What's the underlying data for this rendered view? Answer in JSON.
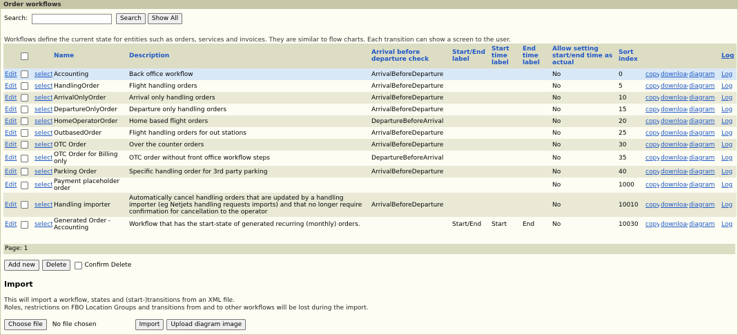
{
  "title": "Order workflows",
  "search": {
    "label": "Search:",
    "value": "",
    "search_button": "Search",
    "show_all_button": "Show All"
  },
  "description": "Workflows define the current state for entities such as orders, services and invoices. They are similar to flow charts. Each transition can show a screen to the user.",
  "columns": {
    "name": "Name",
    "description": "Description",
    "arrival_check": "Arrival before departure check",
    "start_end_label": "Start/End label",
    "start_time_label": "Start time label",
    "end_time_label": "End time label",
    "allow_setting": "Allow setting start/end time as actual",
    "sort_index": "Sort index",
    "log": "Log"
  },
  "row_links": {
    "edit": "Edit",
    "select": "select",
    "copy": "copy",
    "download": "download",
    "diagram": "diagram",
    "log": "Log"
  },
  "rows": [
    {
      "name": "Accounting",
      "description": "Back office workflow",
      "arrival_check": "ArrivalBeforeDeparture",
      "start_end_label": "",
      "start_time_label": "",
      "end_time_label": "",
      "allow_setting": "No",
      "sort_index": "0"
    },
    {
      "name": "HandlingOrder",
      "description": "Flight handling orders",
      "arrival_check": "ArrivalBeforeDeparture",
      "start_end_label": "",
      "start_time_label": "",
      "end_time_label": "",
      "allow_setting": "No",
      "sort_index": "5"
    },
    {
      "name": "ArrivalOnlyOrder",
      "description": "Arrival only handling orders",
      "arrival_check": "ArrivalBeforeDeparture",
      "start_end_label": "",
      "start_time_label": "",
      "end_time_label": "",
      "allow_setting": "No",
      "sort_index": "10"
    },
    {
      "name": "DepartureOnlyOrder",
      "description": "Departure only handling orders",
      "arrival_check": "ArrivalBeforeDeparture",
      "start_end_label": "",
      "start_time_label": "",
      "end_time_label": "",
      "allow_setting": "No",
      "sort_index": "15"
    },
    {
      "name": "HomeOperatorOrder",
      "description": "Home based flight orders",
      "arrival_check": "DepartureBeforeArrival",
      "start_end_label": "",
      "start_time_label": "",
      "end_time_label": "",
      "allow_setting": "No",
      "sort_index": "20"
    },
    {
      "name": "OutbasedOrder",
      "description": "Flight handling orders for out stations",
      "arrival_check": "ArrivalBeforeDeparture",
      "start_end_label": "",
      "start_time_label": "",
      "end_time_label": "",
      "allow_setting": "No",
      "sort_index": "25"
    },
    {
      "name": "OTC Order",
      "description": "Over the counter orders",
      "arrival_check": "ArrivalBeforeDeparture",
      "start_end_label": "",
      "start_time_label": "",
      "end_time_label": "",
      "allow_setting": "No",
      "sort_index": "30"
    },
    {
      "name": "OTC Order for Billing only",
      "description": "OTC order without front office workflow steps",
      "arrival_check": "DepartureBeforeArrival",
      "start_end_label": "",
      "start_time_label": "",
      "end_time_label": "",
      "allow_setting": "No",
      "sort_index": "35"
    },
    {
      "name": "Parking Order",
      "description": "Specific handling order for 3rd party parking",
      "arrival_check": "ArrivalBeforeDeparture",
      "start_end_label": "",
      "start_time_label": "",
      "end_time_label": "",
      "allow_setting": "No",
      "sort_index": "40"
    },
    {
      "name": "Payment placeholder order",
      "description": "",
      "arrival_check": "",
      "start_end_label": "",
      "start_time_label": "",
      "end_time_label": "",
      "allow_setting": "No",
      "sort_index": "1000"
    },
    {
      "name": "Handling importer",
      "description": "Automatically cancel handling orders that are updated by a handling importer (eg Netjets handling requests imports) and that no longer require confirmation for cancellation to the operator",
      "arrival_check": "ArrivalBeforeDeparture",
      "start_end_label": "",
      "start_time_label": "",
      "end_time_label": "",
      "allow_setting": "No",
      "sort_index": "10010"
    },
    {
      "name": "Generated Order - Accounting",
      "description": "Workflow that has the start-state of generated recurring (monthly) orders.",
      "arrival_check": "",
      "start_end_label": "Start/End",
      "start_time_label": "Start",
      "end_time_label": "End",
      "allow_setting": "No",
      "sort_index": "10030"
    }
  ],
  "pager": "Page: 1",
  "actions": {
    "add_new": "Add new",
    "delete": "Delete",
    "confirm_delete": "Confirm Delete"
  },
  "import": {
    "title": "Import",
    "text_line1": "This will import a workflow, states and (start-)transitions from an XML file.",
    "text_line2": "Roles, restrictions on FBO Location Groups and transitions from and to other workflows will be lost during the import.",
    "choose_file": "Choose file",
    "no_file": "No file chosen",
    "import_button": "Import",
    "upload_diagram_button": "Upload diagram image"
  },
  "colors": {
    "header_bg": "#ddddc4",
    "link": "#1f58c7",
    "selected_row": "#d9e8f6",
    "alt_row": "#e9e9d6"
  }
}
